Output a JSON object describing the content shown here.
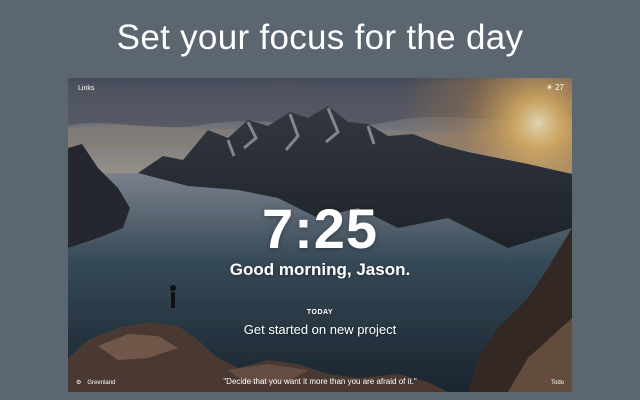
{
  "headline": "Set your focus for the day",
  "topbar": {
    "links_label": "Links"
  },
  "weather": {
    "temperature": "27",
    "icon": "sun-icon"
  },
  "clock": {
    "time": "7:25"
  },
  "greeting": "Good morning, Jason.",
  "focus": {
    "label": "TODAY",
    "task": "Get started on new project"
  },
  "footer": {
    "location": "Greenland",
    "quote": "\"Decide that you want it more than you are afraid of it.\"",
    "todo_label": "Todo"
  }
}
